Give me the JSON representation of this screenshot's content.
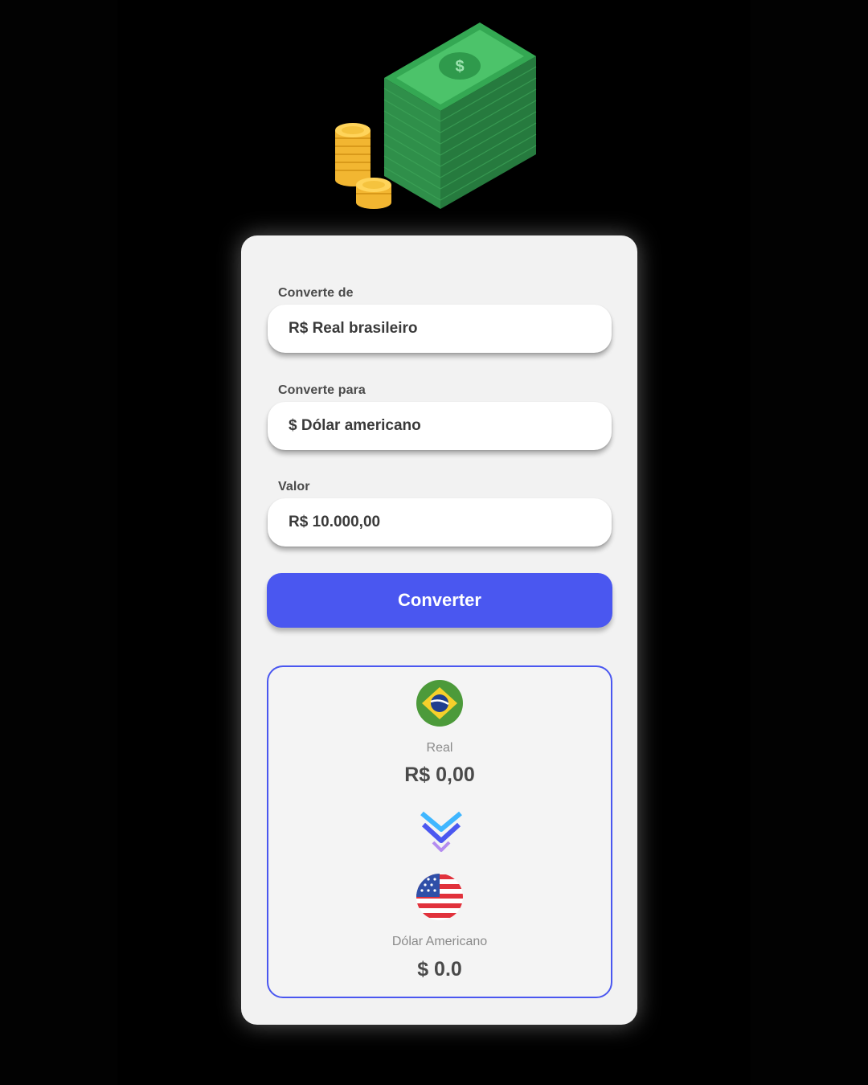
{
  "form": {
    "from_label": "Converte de",
    "from_value": "R$ Real brasileiro",
    "to_label": "Converte para",
    "to_value": "$ Dólar americano",
    "amount_label": "Valor",
    "amount_value": "R$ 10.000,00",
    "convert_button": "Converter"
  },
  "result": {
    "from_currency_name": "Real",
    "from_currency_value": "R$ 0,00",
    "to_currency_name": "Dólar Americano",
    "to_currency_value": "$ 0.0"
  },
  "icons": {
    "hero": "money-stack-icon",
    "from_flag": "brazil-flag-icon",
    "arrow": "double-chevron-down-icon",
    "to_flag": "usa-flag-icon"
  },
  "colors": {
    "accent": "#4a57f0",
    "background": "#000000",
    "card": "#f2f2f2"
  }
}
